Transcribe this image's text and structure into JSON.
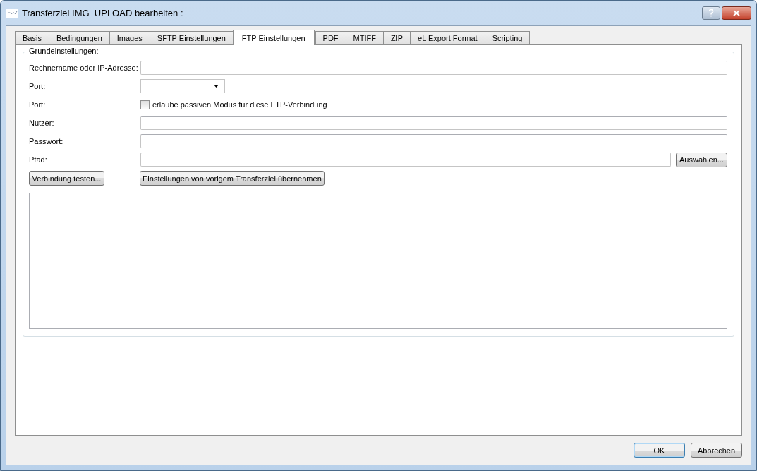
{
  "window": {
    "title": "Transferziel IMG_UPLOAD bearbeiten :"
  },
  "tabs": [
    {
      "label": "Basis",
      "selected": false
    },
    {
      "label": "Bedingungen",
      "selected": false
    },
    {
      "label": "Images",
      "selected": false
    },
    {
      "label": "SFTP Einstellungen",
      "selected": false
    },
    {
      "label": "FTP Einstellungen",
      "selected": true
    },
    {
      "label": "PDF",
      "selected": false
    },
    {
      "label": "MTIFF",
      "selected": false
    },
    {
      "label": "ZIP",
      "selected": false
    },
    {
      "label": "eL Export Format",
      "selected": false
    },
    {
      "label": "Scripting",
      "selected": false
    }
  ],
  "group": {
    "title": "Grundeinstellungen:",
    "rows": [
      {
        "kind": "text",
        "label": "Rechnername oder IP-Adresse:"
      },
      {
        "kind": "combo",
        "label": "Port:"
      },
      {
        "kind": "checkbox",
        "label": "Port:",
        "option": "erlaube passiven Modus für diese FTP-Verbindung",
        "checked": false
      },
      {
        "kind": "text",
        "label": "Nutzer:"
      },
      {
        "kind": "text",
        "label": "Passwort:"
      },
      {
        "kind": "path",
        "label": "Pfad:",
        "button": "Auswählen..."
      }
    ],
    "actions": [
      "Verbindung testen...",
      "Einstellungen von vorigem Transferziel übernehmen"
    ]
  },
  "buttons": [
    {
      "label": "OK",
      "default": true
    },
    {
      "label": "Abbrechen",
      "default": false
    }
  ]
}
